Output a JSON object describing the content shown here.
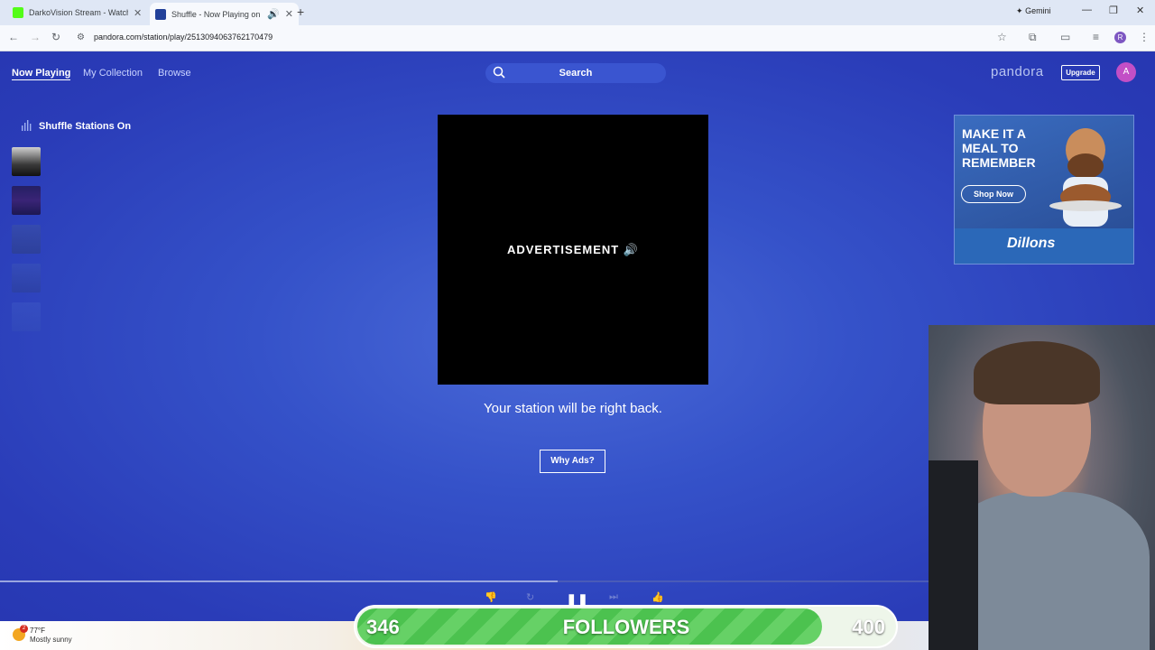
{
  "browser": {
    "tabs": [
      {
        "title": "DarkoVision Stream - Watch Li...",
        "active": false,
        "favicon_color": "#53fc18"
      },
      {
        "title": "Shuffle - Now Playing on Pa...",
        "active": true,
        "favicon_color": "#224099"
      }
    ],
    "gemini_label": "Gemini",
    "url": "pandora.com/station/play/2513094063762170479",
    "profile_initial": "R"
  },
  "pandora": {
    "nav": [
      "Now Playing",
      "My Collection",
      "Browse"
    ],
    "search_label": "Search",
    "logo": "pandora",
    "upgrade_label": "Upgrade",
    "user_initial": "A",
    "shuffle_label": "Shuffle Stations On",
    "ad_label": "ADVERTISEMENT",
    "station_message": "Your station will be right back.",
    "why_ads_label": "Why Ads?",
    "track_progress": 0.6
  },
  "banner_ad": {
    "headline": "MAKE IT A MEAL TO REMEMBER",
    "cta": "Shop Now",
    "brand": "Dillons"
  },
  "taskbar": {
    "weather_badge": "2",
    "temperature": "77°F",
    "condition": "Mostly sunny"
  },
  "followers_goal": {
    "current": "346",
    "label": "FOLLOWERS",
    "target": "400",
    "fill_fraction": 0.865
  },
  "colors": {
    "pandora_bg": "#2b3fbd",
    "goal_green": "#4cc24f",
    "avatar_pink": "#c24fc6"
  }
}
